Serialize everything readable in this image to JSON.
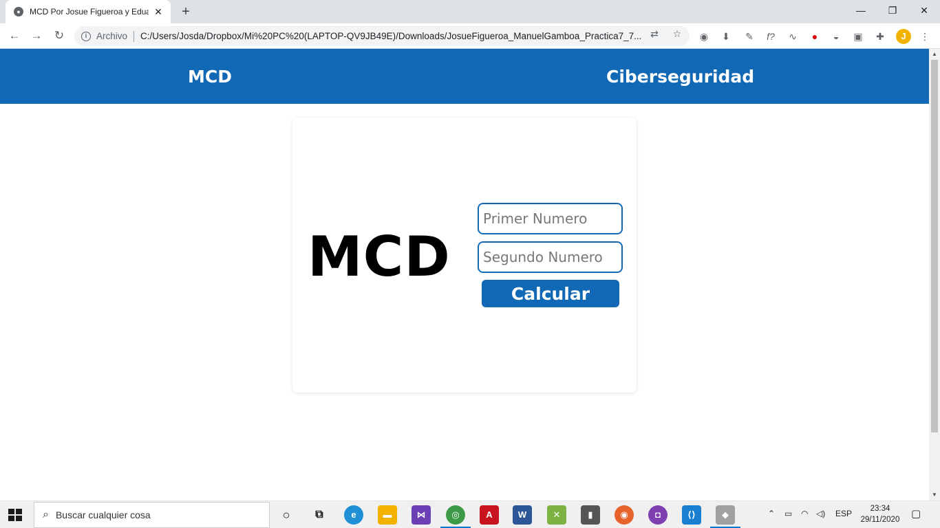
{
  "browser": {
    "tab_title": "MCD Por Josue Figueroa y Eduardo",
    "omnibox_label": "Archivo",
    "url": "C:/Users/Josda/Dropbox/Mi%20PC%20(LAPTOP-QV9JB49E)/Downloads/JosueFigueroa_ManuelGamboa_Practica7_7...",
    "avatar_letter": "J"
  },
  "site": {
    "nav_left": "MCD",
    "nav_right": "Ciberseguridad",
    "brand_color": "#1168b4"
  },
  "card": {
    "title": "MCD",
    "first_placeholder": "Primer Numero",
    "second_placeholder": "Segundo Numero",
    "button_label": "Calcular"
  },
  "taskbar": {
    "search_placeholder": "Buscar cualquier cosa",
    "lang": "ESP",
    "time": "23:34",
    "date": "29/11/2020"
  }
}
